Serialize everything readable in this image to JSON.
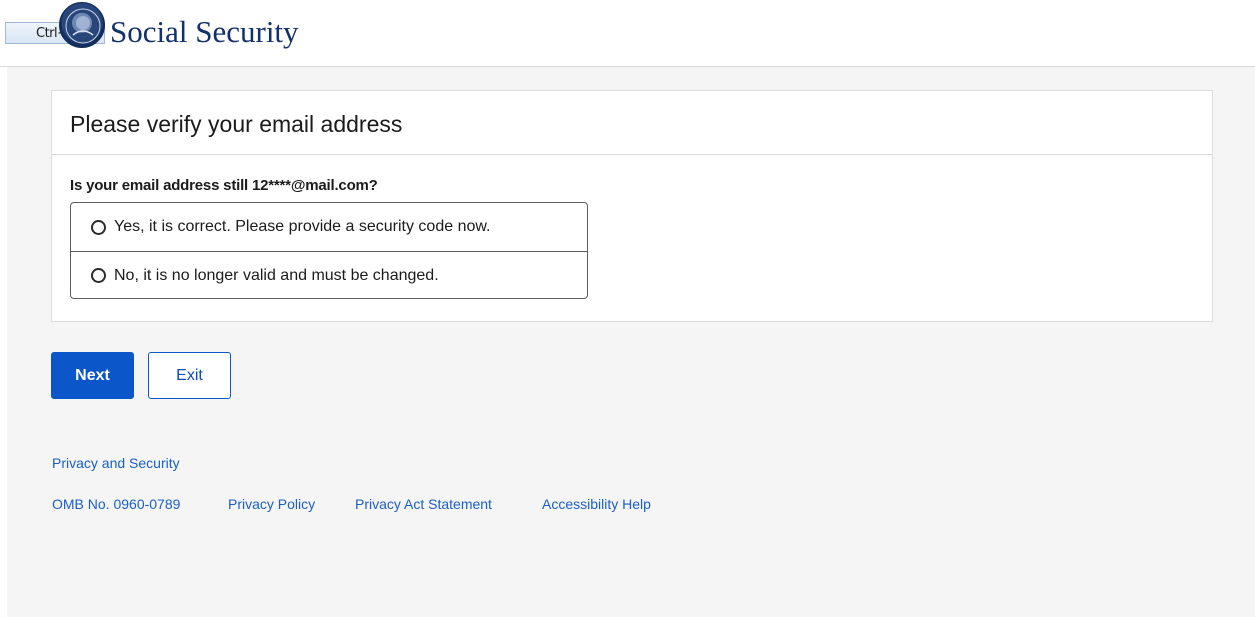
{
  "header": {
    "shortcut_badge": "Ctrl+S",
    "brand_title": "Social Security",
    "logo_icon": "ssa-seal-icon"
  },
  "card": {
    "title": "Please verify your email address",
    "question": "Is your email address still 12****@mail.com?",
    "options": [
      {
        "label": "Yes, it is correct. Please provide a security code now.",
        "selected": false
      },
      {
        "label": "No, it is no longer valid and must be changed.",
        "selected": false
      }
    ]
  },
  "actions": {
    "next_label": "Next",
    "exit_label": "Exit"
  },
  "footer": {
    "privacy_security": "Privacy and Security",
    "omb": "OMB No. 0960-0789",
    "privacy_policy": "Privacy Policy",
    "privacy_act": "Privacy Act Statement",
    "accessibility": "Accessibility Help"
  },
  "colors": {
    "primary_button": "#0b57c9",
    "link": "#1a5fc7",
    "brand_text": "#12306b",
    "page_background": "#f5f5f5"
  }
}
